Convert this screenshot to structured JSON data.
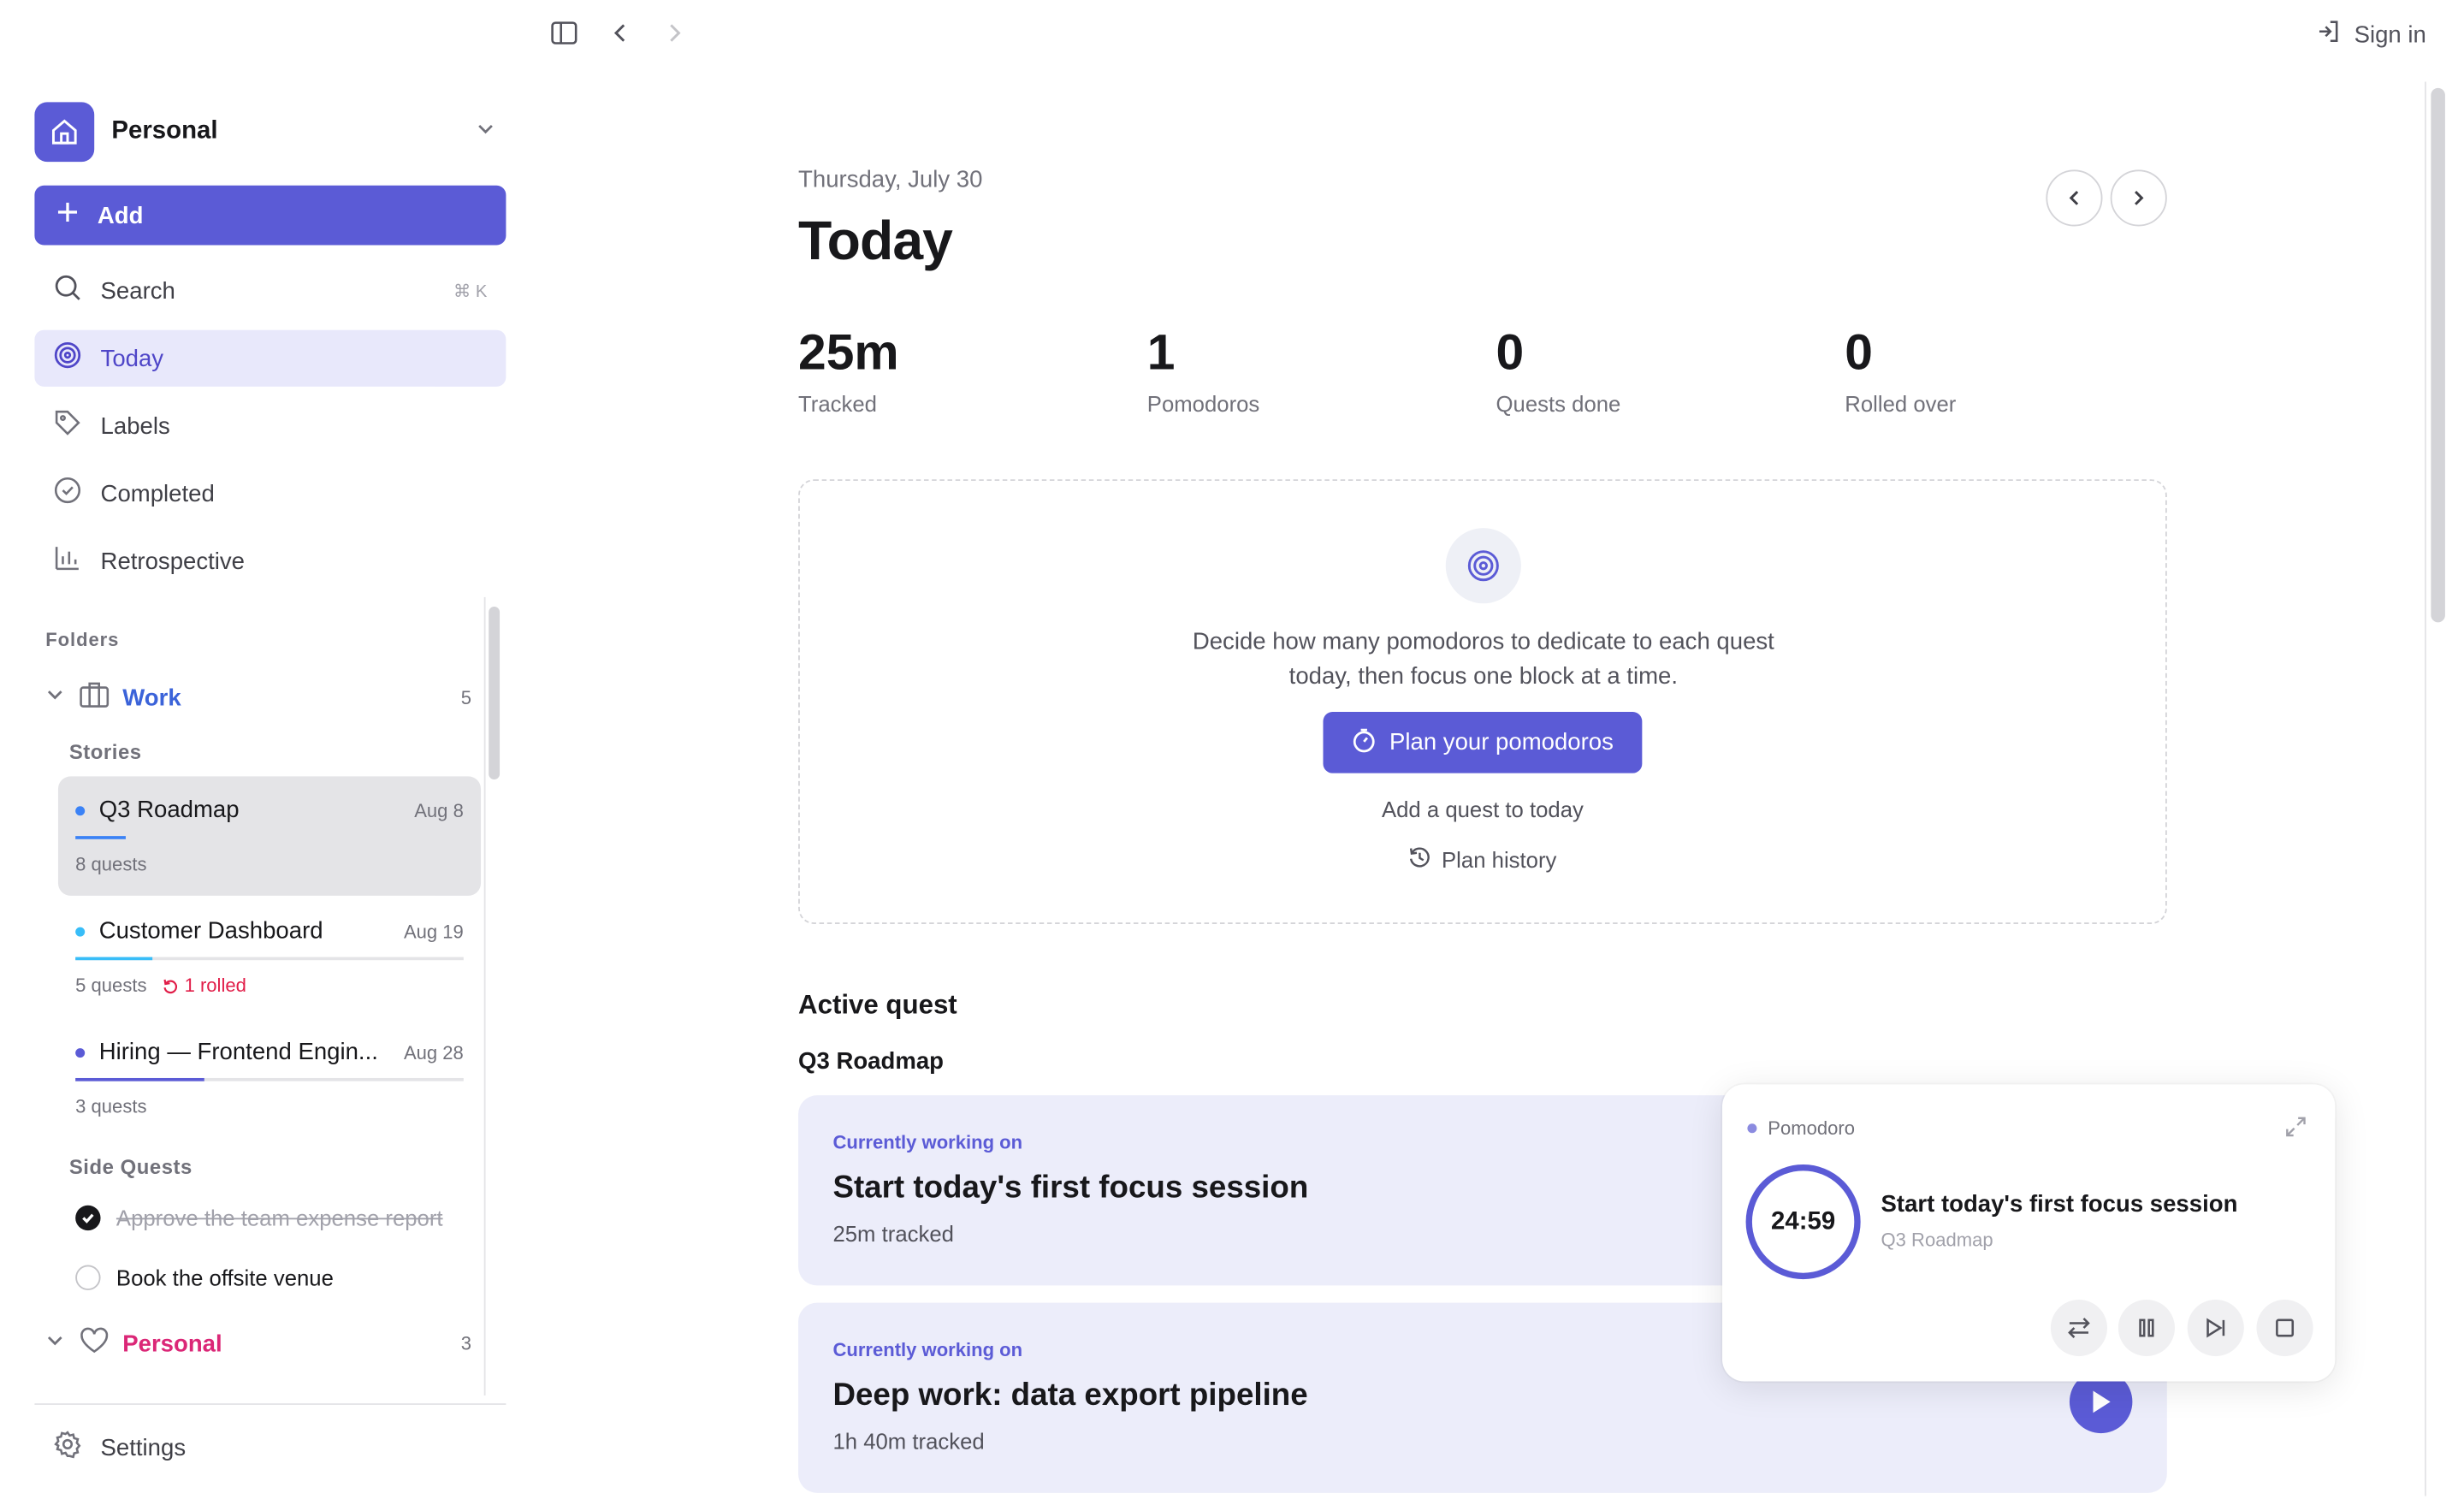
{
  "header": {
    "sign_in": "Sign in"
  },
  "sidebar": {
    "workspace": "Personal",
    "add_label": "Add",
    "search": {
      "label": "Search",
      "shortcut": "⌘ K"
    },
    "nav": [
      {
        "label": "Today",
        "icon": "target-icon"
      },
      {
        "label": "Labels",
        "icon": "tag-icon"
      },
      {
        "label": "Completed",
        "icon": "check-circle-icon"
      },
      {
        "label": "Retrospective",
        "icon": "bar-chart-icon"
      }
    ],
    "folders_label": "Folders",
    "work_folder": {
      "name": "Work",
      "count": "5",
      "color": "#3b63d9",
      "stories_label": "Stories",
      "stories": [
        {
          "title": "Q3 Roadmap",
          "date": "Aug 8",
          "meta": "8 quests",
          "dot": "#3b82f6",
          "bar": "#3b82f6",
          "progress": 0.12
        },
        {
          "title": "Customer Dashboard",
          "date": "Aug 19",
          "meta": "5 quests",
          "rolled": "1 rolled",
          "dot": "#38bdf8",
          "bar": "#38bdf8",
          "progress": 0.2
        },
        {
          "title": "Hiring — Frontend Engin...",
          "date": "Aug 28",
          "meta": "3 quests",
          "dot": "#5b5bd6",
          "bar": "#5b5bd6",
          "progress": 0.33
        }
      ],
      "side_quests_label": "Side Quests",
      "side_quests": [
        {
          "label": "Approve the team expense report",
          "done": true
        },
        {
          "label": "Book the offsite venue",
          "done": false
        }
      ]
    },
    "personal_folder": {
      "name": "Personal",
      "count": "3",
      "color": "#db2777"
    },
    "settings": "Settings"
  },
  "main": {
    "date": "Thursday, July 30",
    "title": "Today",
    "stats": [
      {
        "value": "25m",
        "label": "Tracked"
      },
      {
        "value": "1",
        "label": "Pomodoros"
      },
      {
        "value": "0",
        "label": "Quests done"
      },
      {
        "value": "0",
        "label": "Rolled over"
      }
    ],
    "plan": {
      "description": "Decide how many pomodoros to dedicate to each quest today, then focus one block at a time.",
      "button": "Plan your pomodoros",
      "add_quest": "Add a quest to today",
      "history": "Plan history"
    },
    "active_quest_title": "Active quest",
    "active_story": "Q3 Roadmap",
    "quests": [
      {
        "status": "Currently working on",
        "title": "Start today's first focus session",
        "tracked": "25m tracked"
      },
      {
        "status": "Currently working on",
        "title": "Deep work: data export pipeline",
        "tracked": "1h 40m tracked"
      }
    ]
  },
  "pomodoro": {
    "label": "Pomodoro",
    "time": "24:59",
    "task": "Start today's first focus session",
    "story": "Q3 Roadmap"
  },
  "colors": {
    "accent": "#5b5bd6",
    "accent_bg": "#e8e8fb",
    "card_bg": "#ecedfa"
  }
}
